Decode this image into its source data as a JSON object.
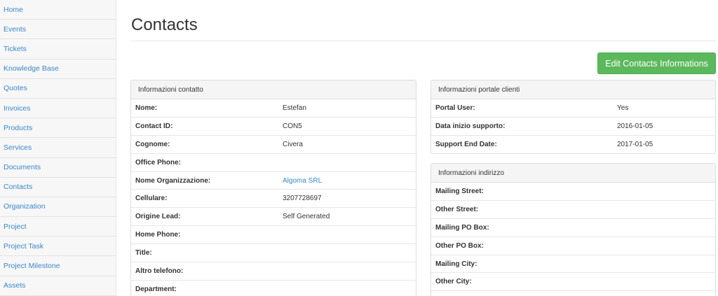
{
  "sidebar": {
    "items": [
      {
        "label": "Home"
      },
      {
        "label": "Events"
      },
      {
        "label": "Tickets"
      },
      {
        "label": "Knowledge Base"
      },
      {
        "label": "Quotes"
      },
      {
        "label": "Invoices"
      },
      {
        "label": "Products"
      },
      {
        "label": "Services"
      },
      {
        "label": "Documents"
      },
      {
        "label": "Contacts"
      },
      {
        "label": "Organization"
      },
      {
        "label": "Project"
      },
      {
        "label": "Project Task"
      },
      {
        "label": "Project Milestone"
      },
      {
        "label": "Assets"
      }
    ]
  },
  "page": {
    "title": "Contacts",
    "edit_button": "Edit Contacts Informations"
  },
  "contact_panel": {
    "heading": "Informazioni contatto",
    "rows": [
      {
        "label": "Nome:",
        "value": "Estefan"
      },
      {
        "label": "Contact ID:",
        "value": "CON5"
      },
      {
        "label": "Cognome:",
        "value": "Civera"
      },
      {
        "label": "Office Phone:",
        "value": ""
      },
      {
        "label": "Nome Organizzazione:",
        "value": "Algoma SRL"
      },
      {
        "label": "Cellulare:",
        "value": "3207728697"
      },
      {
        "label": "Origine Lead:",
        "value": "Self Generated"
      },
      {
        "label": "Home Phone:",
        "value": ""
      },
      {
        "label": "Title:",
        "value": ""
      },
      {
        "label": "Altro telefono:",
        "value": ""
      },
      {
        "label": "Department:",
        "value": ""
      }
    ]
  },
  "portal_panel": {
    "heading": "Informazioni portale clienti",
    "rows": [
      {
        "label": "Portal User:",
        "value": "Yes"
      },
      {
        "label": "Data inizio supporto:",
        "value": "2016-01-05"
      },
      {
        "label": "Support End Date:",
        "value": "2017-01-05"
      }
    ]
  },
  "address_panel": {
    "heading": "Informazioni indirizzo",
    "rows": [
      {
        "label": "Mailing Street:",
        "value": ""
      },
      {
        "label": "Other Street:",
        "value": ""
      },
      {
        "label": "Mailing PO Box:",
        "value": ""
      },
      {
        "label": "Other PO Box:",
        "value": ""
      },
      {
        "label": "Mailing City:",
        "value": ""
      },
      {
        "label": "Other City:",
        "value": ""
      }
    ]
  },
  "colors": {
    "link": "#3a87c8",
    "button_green": "#5cb85c",
    "panel_heading_bg": "#f5f5f5"
  }
}
